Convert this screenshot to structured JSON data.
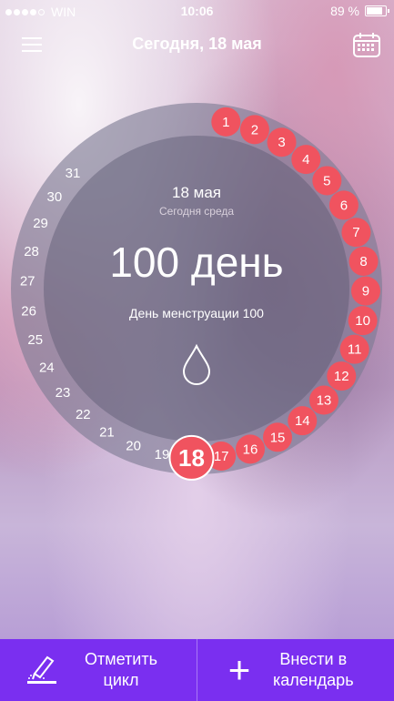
{
  "status_bar": {
    "carrier": "WIN",
    "time": "10:06",
    "battery": "89 %",
    "signal_dots_filled": 4,
    "signal_dots_total": 5
  },
  "header": {
    "title": "Сегодня, 18 мая"
  },
  "cycle": {
    "date": "18 мая",
    "weekday": "Сегодня среда",
    "big_day": "100 день",
    "subtitle": "День менструации 100",
    "current_day": "18",
    "period_days": [
      "1",
      "2",
      "3",
      "4",
      "5",
      "6",
      "7",
      "8",
      "9",
      "10",
      "11",
      "12",
      "13",
      "14",
      "15",
      "16",
      "17"
    ],
    "other_days": [
      "19",
      "20",
      "21",
      "22",
      "23",
      "24",
      "25",
      "26",
      "27",
      "28",
      "29",
      "30",
      "31"
    ],
    "period_color": "#f0535f",
    "ring_color": "#7d7a93"
  },
  "bottom_bar": {
    "mark_cycle": "Отметить цикл",
    "add_to_calendar": "Внести в календарь",
    "color": "#7a2ff0"
  }
}
